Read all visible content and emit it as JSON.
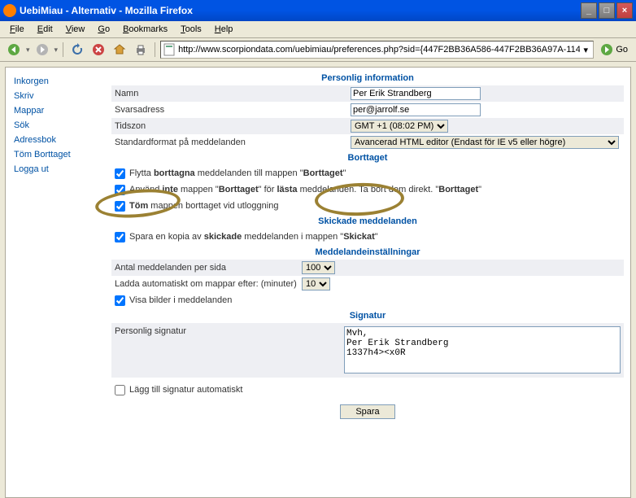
{
  "window": {
    "title": "UebiMiau - Alternativ - Mozilla Firefox"
  },
  "menu": {
    "file": "File",
    "edit": "Edit",
    "view": "View",
    "go": "Go",
    "bookmarks": "Bookmarks",
    "tools": "Tools",
    "help": "Help"
  },
  "url": "http://www.scorpiondata.com/uebimiau/preferences.php?sid={447F2BB36A586-447F2BB36A97A-114",
  "go_label": "Go",
  "sidebar": {
    "items": [
      {
        "label": "Inkorgen"
      },
      {
        "label": "Skriv"
      },
      {
        "label": "Mappar"
      },
      {
        "label": "Sök"
      },
      {
        "label": "Adressbok"
      },
      {
        "label": "Töm Borttaget"
      },
      {
        "label": "Logga ut"
      }
    ]
  },
  "sections": {
    "personal": {
      "title": "Personlig information",
      "name_label": "Namn",
      "name_value": "Per Erik Strandberg",
      "reply_label": "Svarsadress",
      "reply_value": "per@jarrolf.se",
      "tz_label": "Tidszon",
      "tz_value": "GMT +1 (08:02 PM)",
      "fmt_label": "Standardformat på meddelanden",
      "fmt_value": "Avancerad HTML editor (Endast för IE v5 eller högre)"
    },
    "trash": {
      "title": "Borttaget",
      "r1a": "Flytta ",
      "r1b": "borttagna",
      "r1c": " meddelanden till mappen \"",
      "r1d": "Borttaget",
      "r1e": "\"",
      "r2a": "Använd ",
      "r2b": "inte",
      "r2c": " mappen \"",
      "r2d": "Borttaget",
      "r2e": "\" för ",
      "r2f": "lästa",
      "r2g": " meddelanden. Ta bort dem direkt. \"",
      "r2h": "Borttaget",
      "r2i": "\"",
      "r3a": "Töm",
      "r3b": " mappen borttaget vid utloggning"
    },
    "sent": {
      "title": "Skickade meddelanden",
      "r1a": "Spara en kopia av ",
      "r1b": "skickade",
      "r1c": " meddelanden i mappen \"",
      "r1d": "Skickat",
      "r1e": "\""
    },
    "msg": {
      "title": "Meddelandeinställningar",
      "perpage_label": "Antal meddelanden per sida",
      "perpage_value": "100",
      "reload_label": "Ladda automatiskt om mappar efter: (minuter)",
      "reload_value": "10",
      "images_label": "Visa bilder i meddelanden"
    },
    "sig": {
      "title": "Signatur",
      "label": "Personlig signatur",
      "text": "Mvh,\nPer Erik Strandberg\n1337h4><x0R",
      "auto_label": "Lägg till signatur automatiskt"
    }
  },
  "save_label": "Spara"
}
